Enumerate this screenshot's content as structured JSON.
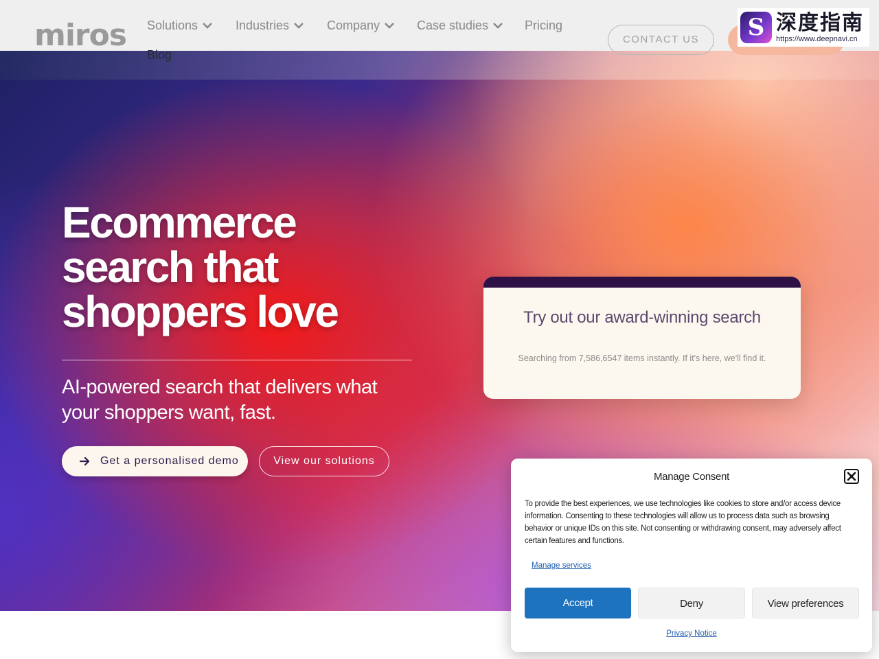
{
  "header": {
    "logo_text": "miros",
    "nav": [
      {
        "label": "Solutions",
        "has_dropdown": true
      },
      {
        "label": "Industries",
        "has_dropdown": true
      },
      {
        "label": "Company",
        "has_dropdown": true
      },
      {
        "label": "Case studies",
        "has_dropdown": true
      },
      {
        "label": "Pricing",
        "has_dropdown": false
      },
      {
        "label": "Blog",
        "has_dropdown": false
      }
    ],
    "contact_label": "CONTACT US"
  },
  "watermark": {
    "title": "深度指南",
    "url": "https://www.deepnavi.cn"
  },
  "hero": {
    "title_lines": [
      "Ecommerce",
      "search that",
      "shoppers love"
    ],
    "subtitle": "AI-powered search that delivers what your shoppers want, fast.",
    "cta_primary": "Get a personalised demo",
    "cta_secondary": "View our solutions"
  },
  "search_card": {
    "title": "Try out our award-winning search",
    "description": "Searching from 7,586,6547 items instantly. If it's here, we'll find it."
  },
  "consent": {
    "title": "Manage Consent",
    "body": "To provide the best experiences, we use technologies like cookies to store and/or access device information. Consenting to these technologies will allow us to process data such as browsing behavior or unique IDs on this site. Not consenting or withdrawing consent, may adversely affect certain features and functions.",
    "manage_services": "Manage services",
    "accept": "Accept",
    "deny": "Deny",
    "view_preferences": "View preferences",
    "privacy_notice": "Privacy Notice"
  },
  "colors": {
    "accent_blue": "#1e73be",
    "card_header": "#2e1246",
    "card_bg": "#fdf8ef"
  }
}
